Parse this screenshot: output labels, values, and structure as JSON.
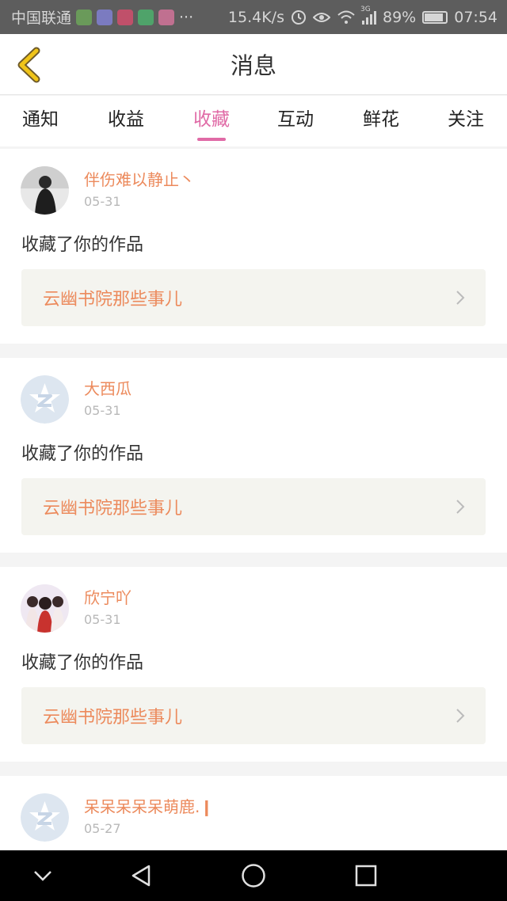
{
  "status_bar": {
    "carrier": "中国联通",
    "more": "···",
    "speed": "15.4K/s",
    "network": "3G",
    "battery": "89%",
    "battery_level": 0.89,
    "time": "07:54"
  },
  "header": {
    "title": "消息",
    "back_icon": "back-chevron-icon",
    "accent_color": "#f0c419"
  },
  "tabs": [
    {
      "label": "通知",
      "active": false
    },
    {
      "label": "收益",
      "active": false
    },
    {
      "label": "收藏",
      "active": true
    },
    {
      "label": "互动",
      "active": false
    },
    {
      "label": "鲜花",
      "active": false
    },
    {
      "label": "关注",
      "active": false
    }
  ],
  "colors": {
    "tab_active": "#e06aa6",
    "username": "#ec8a5c",
    "work_title": "#ec8a5c",
    "work_bg": "#f4f4ef"
  },
  "messages": [
    {
      "user": "伴伤难以静止丶",
      "date": "05-31",
      "text": "收藏了你的作品",
      "work": "云幽书院那些事儿",
      "avatar": "photo-avatar"
    },
    {
      "user": "大西瓜",
      "date": "05-31",
      "text": "收藏了你的作品",
      "work": "云幽书院那些事儿",
      "avatar": "default-avatar"
    },
    {
      "user": "欣宁吖",
      "date": "05-31",
      "text": "收藏了你的作品",
      "work": "云幽书院那些事儿",
      "avatar": "illustration-avatar"
    },
    {
      "user": "呆呆呆呆呆萌鹿.❙",
      "date": "05-27",
      "text": "",
      "work": "",
      "avatar": "default-avatar"
    }
  ],
  "navigation_bar": [
    "back-triangle-icon",
    "home-circle-icon",
    "recents-square-icon",
    "collapse-chevron-icon"
  ]
}
